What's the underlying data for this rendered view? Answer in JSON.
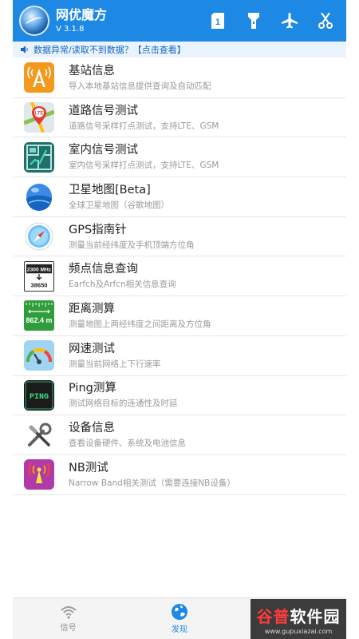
{
  "header": {
    "title": "网优魔方",
    "version": "V 3.1.8",
    "actions": [
      {
        "icon": "sim-card-1-icon",
        "label": "1"
      },
      {
        "icon": "flashlight-icon"
      },
      {
        "icon": "airplane-icon"
      },
      {
        "icon": "scissors-icon"
      }
    ]
  },
  "notice": {
    "text": "数据异常/读取不到数据？【点击查看】"
  },
  "items": [
    {
      "title": "基站信息",
      "subtitle": "导入本地基站信息提供查询及自动匹配",
      "icon": "base-station-icon"
    },
    {
      "title": "道路信号测试",
      "subtitle": "道路信号采样打点测试，支持LTE、GSM",
      "icon": "lte-map-icon",
      "icon_text": "LTE"
    },
    {
      "title": "室内信号测试",
      "subtitle": "室内信号采样打点测试，支持LTE、GSM",
      "icon": "indoor-floorplan-icon"
    },
    {
      "title": "卫星地图[Beta]",
      "subtitle": "全球卫星地图（谷歌地图）",
      "icon": "satellite-map-icon"
    },
    {
      "title": "GPS指南针",
      "subtitle": "测量当前经纬度及手机顶端方位角",
      "icon": "compass-icon"
    },
    {
      "title": "频点信息查询",
      "subtitle": "Earfch及Arfcn相关信息查询",
      "icon": "frequency-icon",
      "icon_text_top": "2300 MHz",
      "icon_text_bottom": "38650"
    },
    {
      "title": "距离测算",
      "subtitle": "测量地图上两经纬度之间距离及方位角",
      "icon": "distance-icon",
      "icon_text": "862.4 m"
    },
    {
      "title": "网速测试",
      "subtitle": "测量当前网络上下行速率",
      "icon": "speedometer-icon"
    },
    {
      "title": "Ping测算",
      "subtitle": "测试网络目标的连通性及时延",
      "icon": "ping-icon",
      "icon_text": "PING"
    },
    {
      "title": "设备信息",
      "subtitle": "查看设备硬件、系统及电池信息",
      "icon": "tools-icon"
    },
    {
      "title": "NB测试",
      "subtitle": "Narrow Band相关测试（需要连接NB设备）",
      "icon": "nb-signal-icon"
    }
  ],
  "tabs": [
    {
      "label": "信号",
      "icon": "wifi-signal-icon",
      "active": false
    },
    {
      "label": "发现",
      "icon": "globe-icon",
      "active": true
    }
  ],
  "watermark": {
    "big_part1": "谷普",
    "big_part2": "软件园",
    "small": "www.gupuxiazai.com"
  },
  "colors": {
    "primary": "#1e88e5",
    "notice_bg": "#eaf4ff",
    "divider": "#e6e6e6"
  }
}
